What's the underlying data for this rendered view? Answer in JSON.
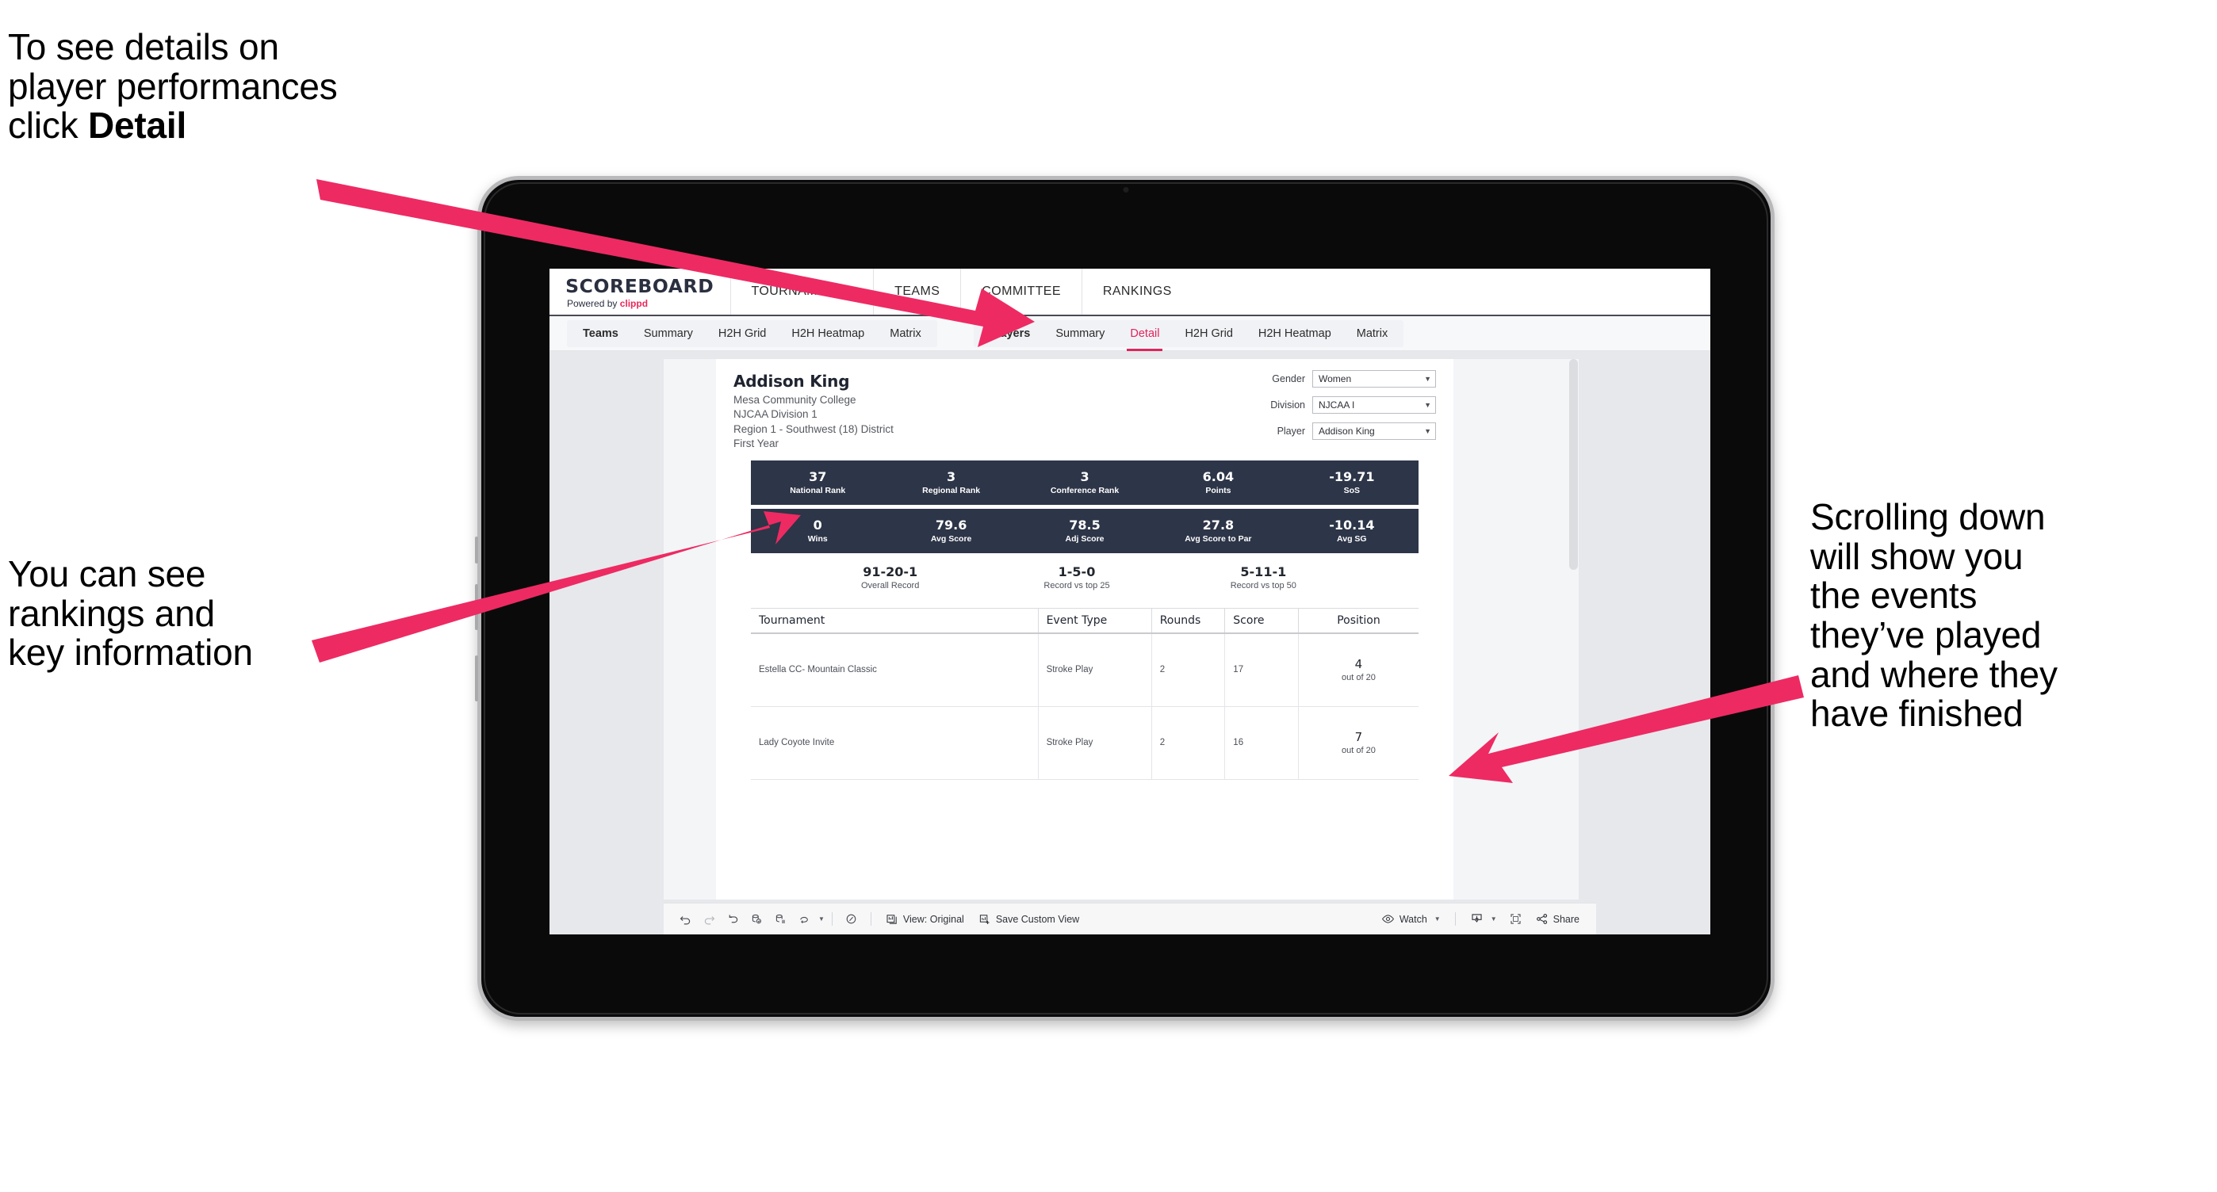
{
  "annotations": {
    "detail": "To see details on\nplayer performances\nclick ",
    "detail_bold": "Detail",
    "rankings": "You can see\nrankings and\nkey information",
    "scrolling": "Scrolling down\nwill show you\nthe events\nthey’ve played\nand where they\nhave finished"
  },
  "brand": {
    "wordmark": "SCOREBOARD",
    "powered_prefix": "Powered by ",
    "powered_name": "clippd"
  },
  "topnav": {
    "items": [
      "TOURNAMENTS",
      "TEAMS",
      "COMMITTEE",
      "RANKINGS"
    ]
  },
  "subnav": {
    "group_teams": [
      "Teams",
      "Summary",
      "H2H Grid",
      "H2H Heatmap",
      "Matrix"
    ],
    "group_players": [
      "Players",
      "Summary",
      "Detail",
      "H2H Grid",
      "H2H Heatmap",
      "Matrix"
    ],
    "active": "Detail"
  },
  "player": {
    "name": "Addison King",
    "school": "Mesa Community College",
    "division": "NJCAA Division 1",
    "region": "Region 1 - Southwest (18) District",
    "year": "First Year"
  },
  "filters": [
    {
      "label": "Gender",
      "value": "Women"
    },
    {
      "label": "Division",
      "value": "NJCAA I"
    },
    {
      "label": "Player",
      "value": "Addison King"
    }
  ],
  "stats_band_1": [
    {
      "value": "37",
      "label": "National Rank"
    },
    {
      "value": "3",
      "label": "Regional Rank"
    },
    {
      "value": "3",
      "label": "Conference Rank"
    },
    {
      "value": "6.04",
      "label": "Points"
    },
    {
      "value": "-19.71",
      "label": "SoS"
    }
  ],
  "stats_band_2": [
    {
      "value": "0",
      "label": "Wins"
    },
    {
      "value": "79.6",
      "label": "Avg Score"
    },
    {
      "value": "78.5",
      "label": "Adj Score"
    },
    {
      "value": "27.8",
      "label": "Avg Score to Par"
    },
    {
      "value": "-10.14",
      "label": "Avg SG"
    }
  ],
  "records": [
    {
      "value": "91-20-1",
      "label": "Overall Record"
    },
    {
      "value": "1-5-0",
      "label": "Record vs top 25"
    },
    {
      "value": "5-11-1",
      "label": "Record vs top 50"
    }
  ],
  "table": {
    "headers": [
      "Tournament",
      "Event Type",
      "Rounds",
      "Score",
      "Position"
    ],
    "rows": [
      {
        "tournament": "Estella CC- Mountain Classic",
        "event_type": "Stroke Play",
        "rounds": "2",
        "score": "17",
        "position": "4",
        "position_of": "out of 20"
      },
      {
        "tournament": "Lady Coyote Invite",
        "event_type": "Stroke Play",
        "rounds": "2",
        "score": "16",
        "position": "7",
        "position_of": "out of 20"
      }
    ]
  },
  "toolbar": {
    "view_label": "View: Original",
    "save_label": "Save Custom View",
    "watch_label": "Watch",
    "share_label": "Share"
  },
  "colors": {
    "accent_pink": "#e8285c",
    "band_navy": "#2d3548",
    "arrow_pink": "#ee2a62"
  }
}
